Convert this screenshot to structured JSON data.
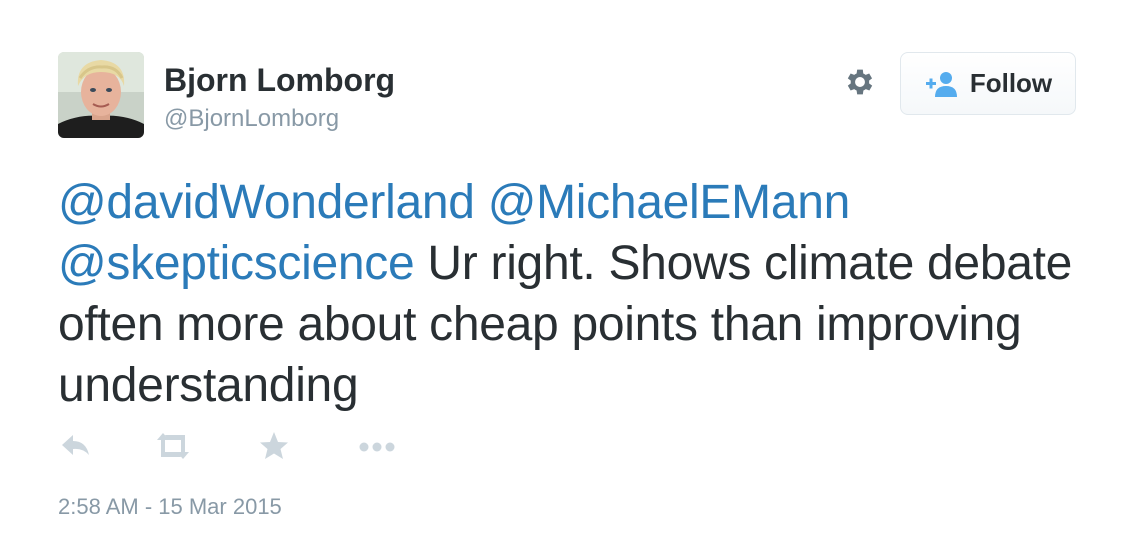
{
  "user": {
    "display_name": "Bjorn Lomborg",
    "screen_name": "@BjornLomborg"
  },
  "header": {
    "settings_icon": "gear-icon",
    "follow_icon": "add-user-icon",
    "follow_label": "Follow"
  },
  "tweet": {
    "mention_1": "@davidWonderland",
    "mention_2": "@MichaelEMann",
    "mention_3": "@skepticscience",
    "body": "Ur right. Shows climate debate often more about cheap points than improving understanding"
  },
  "actions": {
    "reply_icon": "reply-icon",
    "retweet_icon": "retweet-icon",
    "favorite_icon": "star-icon",
    "more_icon": "more-dots-icon"
  },
  "timestamp": "2:58 AM - 15 Mar 2015",
  "colors": {
    "text": "#292f33",
    "muted": "#8899a6",
    "link": "#2b7bb9",
    "icon": "#ccd6dd",
    "follow_icon": "#55acee"
  }
}
